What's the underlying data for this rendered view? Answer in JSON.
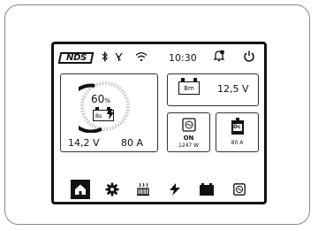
{
  "status_bar": {
    "brand": "NDS",
    "time": "10:30",
    "icons": [
      "bluetooth-icon",
      "signal-icon",
      "wifi-icon",
      "bell-icon",
      "power-icon"
    ]
  },
  "main_battery": {
    "percent": "60",
    "percent_unit": "%",
    "label": "Bs",
    "voltage": "14,2 V",
    "current": "80 A",
    "charge_fraction": 0.6
  },
  "motor_battery": {
    "label": "Bm",
    "voltage": "12,5 V"
  },
  "inverter": {
    "state": "ON",
    "power": "1247 W"
  },
  "dcdc": {
    "label": "Dc",
    "current": "80 A"
  },
  "nav": {
    "items": [
      "home-icon",
      "settings-icon",
      "heater-icon",
      "charging-icon",
      "battery-icon",
      "inverter-icon"
    ],
    "active": "home-icon"
  }
}
